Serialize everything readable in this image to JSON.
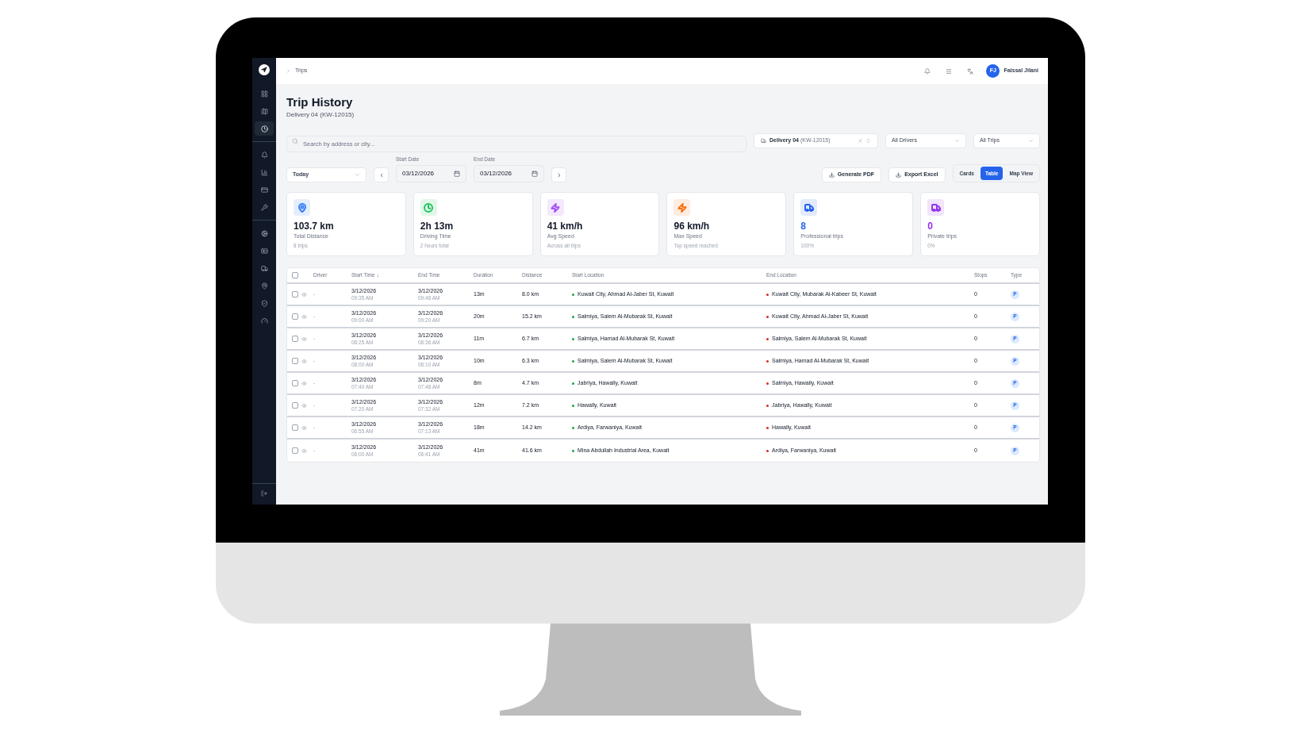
{
  "sidebar": {
    "items": [
      {
        "selected": false
      },
      {
        "selected": false
      },
      {
        "selected": true
      },
      {
        "selected": false
      },
      {
        "selected": false
      },
      {
        "selected": false
      },
      {
        "selected": false
      },
      {
        "selected": false
      },
      {
        "selected": false
      },
      {
        "selected": false
      },
      {
        "selected": false
      },
      {
        "selected": false
      },
      {
        "selected": false
      }
    ]
  },
  "header": {
    "breadcrumb": "Trips",
    "user": {
      "initials": "FJ",
      "name": "Faissal Jilani"
    }
  },
  "page": {
    "title": "Trip History",
    "subtitle": "Delivery 04 (KW-12015)"
  },
  "filters": {
    "search": {
      "placeholder": "Search by address or city..."
    },
    "vehicle": {
      "value": "Delivery 04",
      "detail": "(KW-12015)"
    },
    "driver": {
      "value": "All Drivers"
    },
    "trip_type": {
      "value": "All Trips"
    }
  },
  "dates": {
    "range": {
      "value": "Today"
    },
    "start": {
      "label": "Start Date",
      "value": "03/12/2026"
    },
    "end": {
      "label": "End Date",
      "value": "03/12/2026"
    }
  },
  "actions": [
    "Generate PDF",
    "Export Excel"
  ],
  "views": [
    {
      "label": "Cards",
      "selected": false
    },
    {
      "label": "Table",
      "selected": true
    },
    {
      "label": "Map View",
      "selected": false
    }
  ],
  "stats": [
    {
      "value": "103.7 km",
      "label": "Total Distance",
      "sub": "8 trips",
      "color": "#3b82f6",
      "accent_value": false
    },
    {
      "value": "2h 13m",
      "label": "Driving Time",
      "sub": "2 hours total",
      "color": "#22c55e",
      "accent_value": false
    },
    {
      "value": "41 km/h",
      "label": "Avg Speed",
      "sub": "Across all trips",
      "color": "#a855f7",
      "accent_value": false
    },
    {
      "value": "96 km/h",
      "label": "Max Speed",
      "sub": "Top speed reached",
      "color": "#f97316",
      "accent_value": false
    },
    {
      "value": "8",
      "label": "Professional trips",
      "sub": "100%",
      "color": "#2563eb",
      "accent_value": true
    },
    {
      "value": "0",
      "label": "Private trips",
      "sub": "0%",
      "color": "#9333ea",
      "accent_value": true
    }
  ],
  "table": {
    "header_checked": false,
    "columns": [
      "Driver",
      "Start Time ↓",
      "End Time",
      "Duration",
      "Distance",
      "Start Location",
      "End Location",
      "Stops",
      "Type"
    ],
    "rows": [
      {
        "checked": false,
        "driver": "-",
        "start_date": "3/12/2026",
        "start_time": "09:35 AM",
        "end_date": "3/12/2026",
        "end_time": "09:48 AM",
        "duration": "13m",
        "distance": "8.0 km",
        "start_location": "Kuwait City, Ahmad Al-Jaber St, Kuwait",
        "end_location": "Kuwait City, Mubarak Al-Kabeer St, Kuwait",
        "stops": "0",
        "type": "P"
      },
      {
        "checked": false,
        "driver": "-",
        "start_date": "3/12/2026",
        "start_time": "09:00 AM",
        "end_date": "3/12/2026",
        "end_time": "09:20 AM",
        "duration": "20m",
        "distance": "15.2 km",
        "start_location": "Salmiya, Salem Al-Mubarak St, Kuwait",
        "end_location": "Kuwait City, Ahmad Al-Jaber St, Kuwait",
        "stops": "0",
        "type": "P"
      },
      {
        "checked": false,
        "driver": "-",
        "start_date": "3/12/2026",
        "start_time": "08:25 AM",
        "end_date": "3/12/2026",
        "end_time": "08:36 AM",
        "duration": "11m",
        "distance": "6.7 km",
        "start_location": "Salmiya, Hamad Al-Mubarak St, Kuwait",
        "end_location": "Salmiya, Salem Al-Mubarak St, Kuwait",
        "stops": "0",
        "type": "P"
      },
      {
        "checked": false,
        "driver": "-",
        "start_date": "3/12/2026",
        "start_time": "08:00 AM",
        "end_date": "3/12/2026",
        "end_time": "08:10 AM",
        "duration": "10m",
        "distance": "6.3 km",
        "start_location": "Salmiya, Salem Al-Mubarak St, Kuwait",
        "end_location": "Salmiya, Hamad Al-Mubarak St, Kuwait",
        "stops": "0",
        "type": "P"
      },
      {
        "checked": false,
        "driver": "-",
        "start_date": "3/12/2026",
        "start_time": "07:40 AM",
        "end_date": "3/12/2026",
        "end_time": "07:48 AM",
        "duration": "8m",
        "distance": "4.7 km",
        "start_location": "Jabriya, Hawally, Kuwait",
        "end_location": "Salmiya, Hawally, Kuwait",
        "stops": "0",
        "type": "P"
      },
      {
        "checked": false,
        "driver": "-",
        "start_date": "3/12/2026",
        "start_time": "07:20 AM",
        "end_date": "3/12/2026",
        "end_time": "07:32 AM",
        "duration": "12m",
        "distance": "7.2 km",
        "start_location": "Hawally, Kuwait",
        "end_location": "Jabriya, Hawally, Kuwait",
        "stops": "0",
        "type": "P"
      },
      {
        "checked": false,
        "driver": "-",
        "start_date": "3/12/2026",
        "start_time": "06:55 AM",
        "end_date": "3/12/2026",
        "end_time": "07:13 AM",
        "duration": "18m",
        "distance": "14.2 km",
        "start_location": "Ardiya, Farwaniya, Kuwait",
        "end_location": "Hawally, Kuwait",
        "stops": "0",
        "type": "P"
      },
      {
        "checked": false,
        "driver": "-",
        "start_date": "3/12/2026",
        "start_time": "06:00 AM",
        "end_date": "3/12/2026",
        "end_time": "06:41 AM",
        "duration": "41m",
        "distance": "41.6 km",
        "start_location": "Mina Abdullah Industrial Area, Kuwait",
        "end_location": "Ardiya, Farwaniya, Kuwait",
        "stops": "0",
        "type": "P"
      }
    ]
  }
}
